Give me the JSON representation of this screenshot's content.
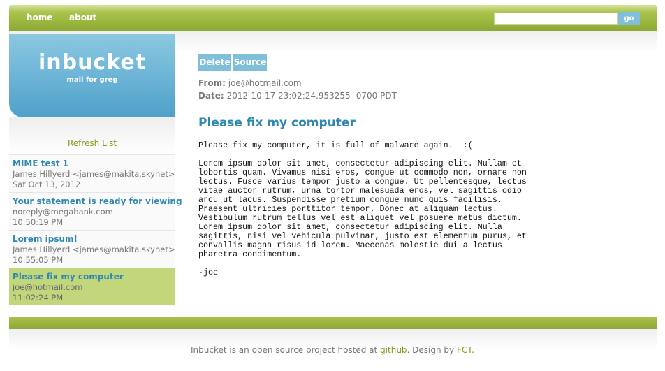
{
  "nav": {
    "home": "home",
    "about": "about"
  },
  "search": {
    "value": "",
    "button": "go"
  },
  "brand": {
    "title": "inbucket",
    "subtitle": "mail for greg"
  },
  "sidebar": {
    "refresh": "Refresh List",
    "messages": [
      {
        "subject": "MIME test 1",
        "from": "James Hillyerd <james@makita.skynet>",
        "date": "Sat Oct 13, 2012"
      },
      {
        "subject": "Your statement is ready for viewing",
        "from": "noreply@megabank.com",
        "date": "10:50:19 PM"
      },
      {
        "subject": "Lorem ipsum!",
        "from": "James Hillyerd <james@makita.skynet>",
        "date": "10:55:05 PM"
      },
      {
        "subject": "Please fix my computer",
        "from": "joe@hotmail.com",
        "date": "11:02:24 PM",
        "selected": true
      }
    ]
  },
  "message": {
    "buttons": {
      "delete": "Delete",
      "source": "Source"
    },
    "from_label": "From:",
    "from": "joe@hotmail.com",
    "date_label": "Date:",
    "date": "2012-10-17 23:02:24.953255 -0700 PDT",
    "subject": "Please fix my computer",
    "body": "Please fix my computer, it is full of malware again.  :(\n\nLorem ipsum dolor sit amet, consectetur adipiscing elit. Nullam et\nlobortis quam. Vivamus nisi eros, congue ut commodo non, ornare non\nlectus. Fusce varius tempor justo a congue. Ut pellentesque, lectus\nvitae auctor rutrum, urna tortor malesuada eros, vel sagittis odio\narcu ut lacus. Suspendisse pretium congue nunc quis facilisis.\nPraesent ultricies porttitor tempor. Donec at aliquam lectus.\nVestibulum rutrum tellus vel est aliquet vel posuere metus dictum.\nLorem ipsum dolor sit amet, consectetur adipiscing elit. Nulla\nsagittis, nisi vel vehicula pulvinar, justo est elementum purus, et\nconvallis magna risus id lorem. Maecenas molestie dui a lectus\npharetra condimentum.\n\n-joe"
  },
  "footer": {
    "prefix": "Inbucket is an open source project hosted at ",
    "github": "github",
    "middle": ". Design by ",
    "fct": "FCT",
    "suffix": "."
  },
  "colors": {
    "green": "#9ab53e",
    "blue": "#6ab3d6",
    "link": "#2e88b3",
    "selected": "#c2d67c"
  }
}
